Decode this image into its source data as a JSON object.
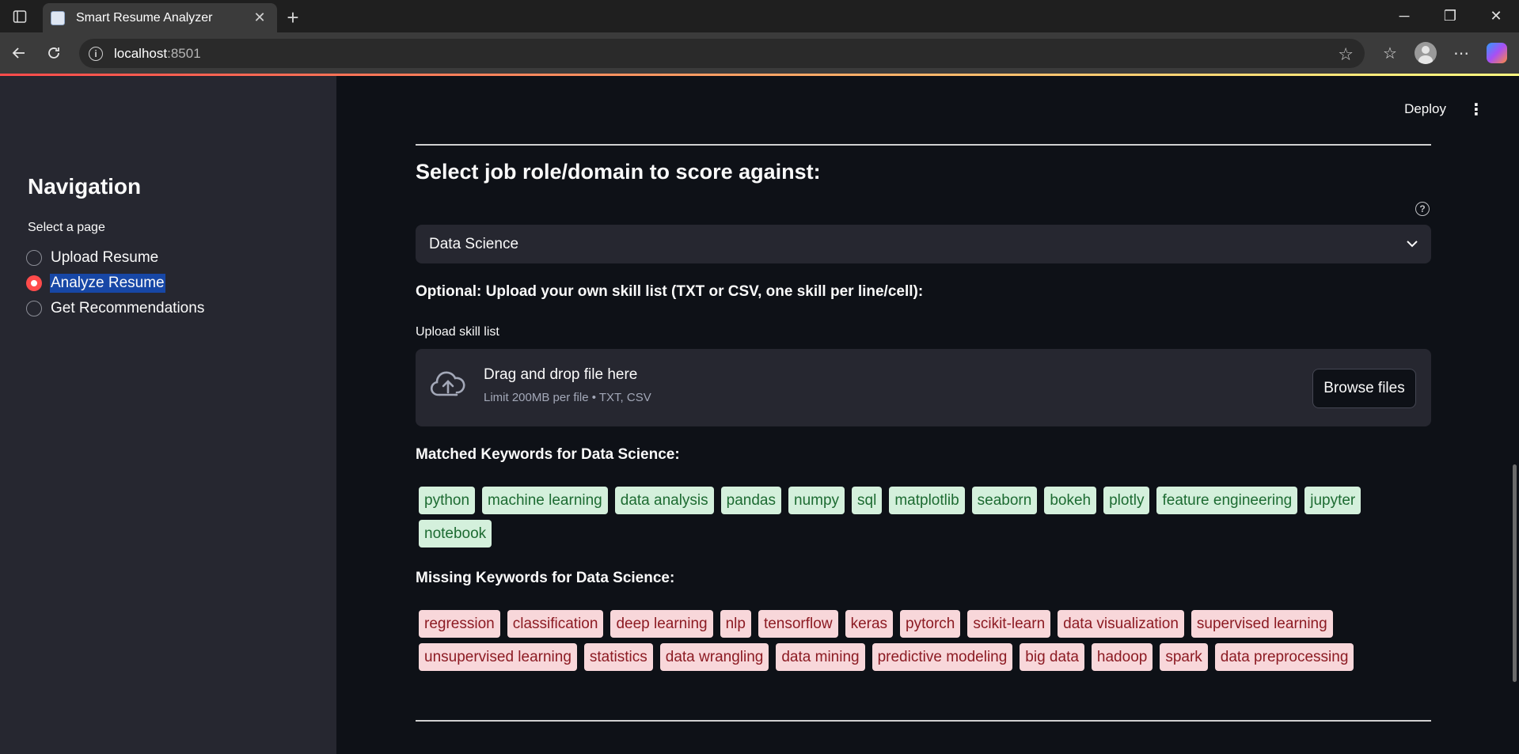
{
  "browser": {
    "tab_title": "Smart Resume Analyzer",
    "url_host": "localhost",
    "url_port": ":8501"
  },
  "sidebar": {
    "heading": "Navigation",
    "select_label": "Select a page",
    "options": [
      "Upload Resume",
      "Analyze Resume",
      "Get Recommendations"
    ],
    "selected_index": 1
  },
  "header": {
    "deploy_label": "Deploy"
  },
  "main": {
    "section_title": "Select job role/domain to score against:",
    "role_select_value": "Data Science",
    "optional_text": "Optional: Upload your own skill list (TXT or CSV, one skill per line/cell):",
    "upload_label": "Upload skill list",
    "dropzone_title": "Drag and drop file here",
    "dropzone_sub": "Limit 200MB per file • TXT, CSV",
    "browse_label": "Browse files",
    "matched_heading": "Matched Keywords for Data Science:",
    "matched_keywords": [
      "python",
      "machine learning",
      "data analysis",
      "pandas",
      "numpy",
      "sql",
      "matplotlib",
      "seaborn",
      "bokeh",
      "plotly",
      "feature engineering",
      "jupyter",
      "notebook"
    ],
    "missing_heading": "Missing Keywords for Data Science:",
    "missing_keywords": [
      "regression",
      "classification",
      "deep learning",
      "nlp",
      "tensorflow",
      "keras",
      "pytorch",
      "scikit-learn",
      "data visualization",
      "supervised learning",
      "unsupervised learning",
      "statistics",
      "data wrangling",
      "data mining",
      "predictive modeling",
      "big data",
      "hadoop",
      "spark",
      "data preprocessing"
    ]
  },
  "colors": {
    "accent": "#ff4b4b",
    "matched_chip_bg": "#d4f0dc",
    "missing_chip_bg": "#f8d7da"
  }
}
